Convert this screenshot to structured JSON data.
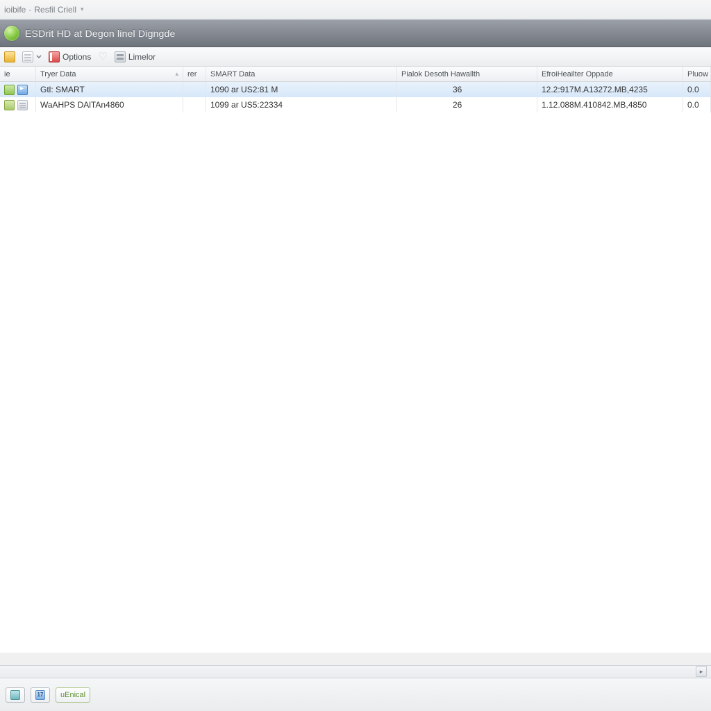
{
  "titlebar": {
    "left": "ioibife",
    "right": "Resfil Criell"
  },
  "header": {
    "title": "ESDrit HD at Degon linel Digngde"
  },
  "toolbar": {
    "options_label": "Options",
    "limelor_label": "Limelor"
  },
  "columns": {
    "c0": "ie",
    "c1": "Tryer Data",
    "c2": "rer",
    "c3": "SMART Data",
    "c4": "Pialok Desoth Hawallth",
    "c5": "EfroiHeailter Oppade",
    "c6": "Pluow"
  },
  "rows": [
    {
      "name": "Gtl: SMART",
      "smart": "1090 ar US2:81 M",
      "health": "36",
      "oppade": "12.2:917M.A13272.MB,4235",
      "pluow": "0.0"
    },
    {
      "name": "WaAHPS DAlTAn4860",
      "smart": "1099 ar US5:22334",
      "health": "26",
      "oppade": "1.12.088M.410842.MB,4850",
      "pluow": "0.0"
    }
  ],
  "statusbar": {
    "badge_num": "17",
    "button_label": "uEnical"
  }
}
